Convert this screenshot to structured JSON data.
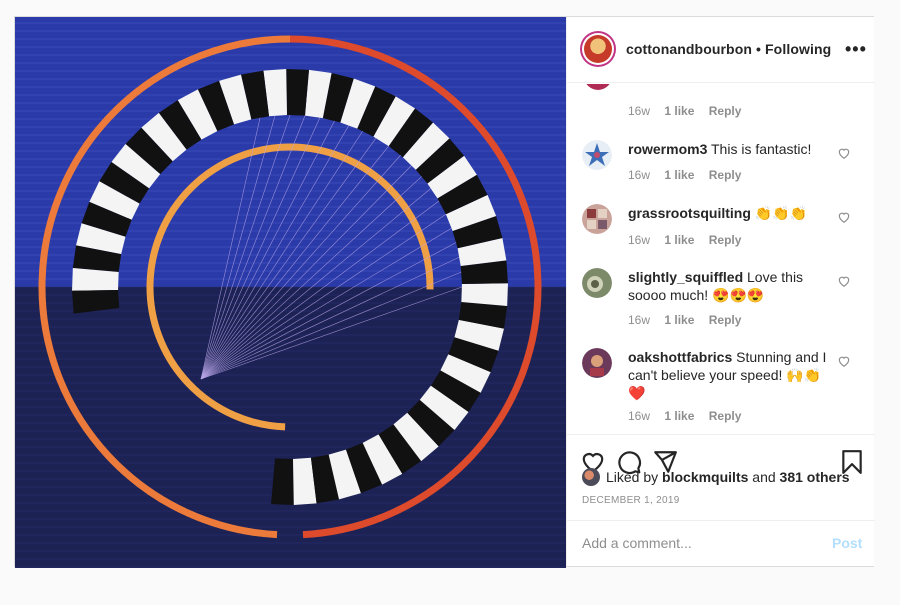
{
  "header": {
    "username": "cottonandbourbon",
    "separator": "•",
    "follow_label": "Following",
    "more_icon": "more-horizontal-icon"
  },
  "comments": {
    "top_partial": {
      "time": "16w",
      "likes": "1 like",
      "reply": "Reply"
    },
    "items": [
      {
        "user": "rowermom3",
        "text": "This is fantastic!",
        "time": "16w",
        "likes": "1 like",
        "reply": "Reply"
      },
      {
        "user": "grassrootsquilting",
        "text": "👏👏👏",
        "time": "16w",
        "likes": "1 like",
        "reply": "Reply"
      },
      {
        "user": "slightly_squiffled",
        "text": "Love this soooo much! 😍😍😍",
        "time": "16w",
        "likes": "1 like",
        "reply": "Reply"
      },
      {
        "user": "oakshottfabrics",
        "text": "Stunning and I can't believe your speed! 🙌👏❤️",
        "time": "16w",
        "likes": "1 like",
        "reply": "Reply"
      }
    ]
  },
  "actions": {
    "like_icon": "heart-icon",
    "comment_icon": "comment-icon",
    "share_icon": "send-icon",
    "save_icon": "bookmark-icon"
  },
  "likes_summary": {
    "prefix": "Liked by",
    "user": "blockmquilts",
    "joiner": "and",
    "others": "381 others"
  },
  "date": "DECEMBER 1, 2019",
  "add_comment": {
    "placeholder": "Add a comment...",
    "post_label": "Post"
  },
  "colors": {
    "quilt_top": "#2a3aa8",
    "quilt_bottom": "#1d2255",
    "orange_outer_left": "#ec7a3a",
    "orange_outer_right": "#dd4a2c",
    "orange_inner": "#f0a044",
    "post_link": "#b2dffc"
  }
}
